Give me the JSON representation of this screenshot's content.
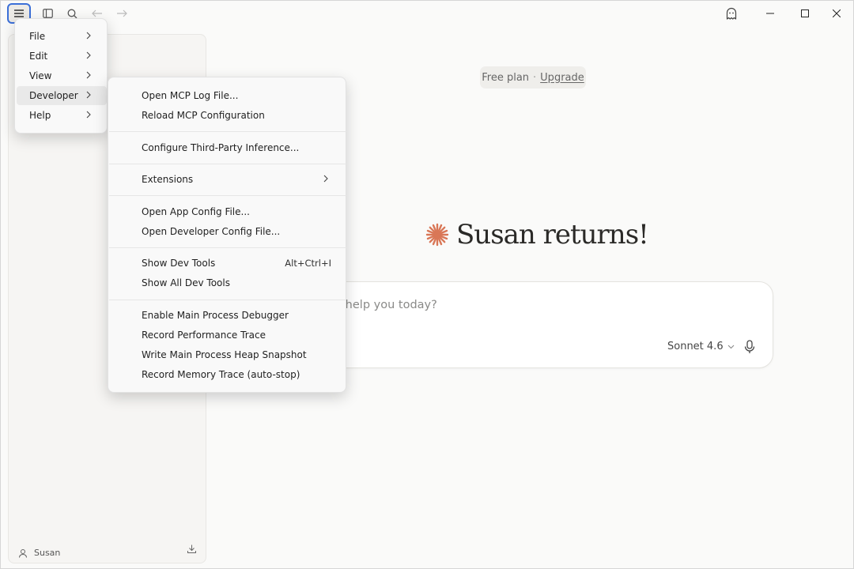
{
  "app_menu": {
    "items": [
      {
        "label": "File"
      },
      {
        "label": "Edit"
      },
      {
        "label": "View"
      },
      {
        "label": "Developer"
      },
      {
        "label": "Help"
      }
    ],
    "active_index": 3
  },
  "developer_menu": {
    "items": [
      {
        "label": "Open MCP Log File..."
      },
      {
        "label": "Reload MCP Configuration"
      },
      {
        "label": "Configure Third-Party Inference..."
      },
      {
        "label": "Extensions"
      },
      {
        "label": "Open App Config File..."
      },
      {
        "label": "Open Developer Config File..."
      },
      {
        "label": "Show Dev Tools",
        "accelerator": "Alt+Ctrl+I"
      },
      {
        "label": "Show All Dev Tools"
      },
      {
        "label": "Enable Main Process Debugger"
      },
      {
        "label": "Record Performance Trace"
      },
      {
        "label": "Write Main Process Heap Snapshot"
      },
      {
        "label": "Record Memory Trace (auto-stop)"
      }
    ]
  },
  "plan": {
    "label": "Free plan",
    "separator": "·",
    "upgrade": "Upgrade"
  },
  "greeting": "Susan returns!",
  "composer": {
    "placeholder": "n I help you today?",
    "model": "Sonnet 4.6"
  },
  "sidebar": {
    "user_name": "Susan"
  },
  "colors": {
    "accent": "#d97757",
    "focus_ring": "#3b6fd8"
  },
  "icons": [
    "menu-icon",
    "sidebar-toggle-icon",
    "search-icon",
    "back-arrow-icon",
    "forward-arrow-icon",
    "ghost-icon",
    "minimize-icon",
    "maximize-icon",
    "close-icon",
    "user-icon",
    "download-icon",
    "mic-icon",
    "chevron-right-icon",
    "chevron-down-icon",
    "asterisk-logo-icon"
  ]
}
